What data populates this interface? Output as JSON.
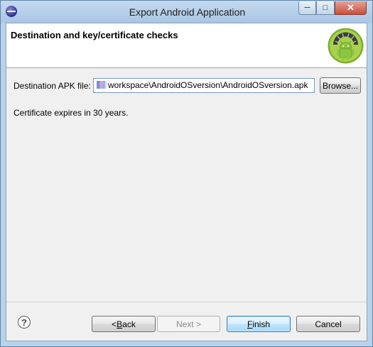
{
  "window": {
    "title": "Export Android Application",
    "icons": {
      "app": "eclipse-icon",
      "minimize": "minimize-icon",
      "maximize": "maximize-icon",
      "close": "close-icon"
    },
    "minimize_glyph": "─",
    "maximize_glyph": "□",
    "close_glyph": "✕"
  },
  "banner": {
    "title": "Destination and key/certificate checks",
    "logo_icon": "android-logo-icon"
  },
  "destination": {
    "label": "Destination APK file:",
    "value": "workspace\\AndroidOSversion\\AndroidOSversion.apk",
    "browse_label": "Browse..."
  },
  "certificate_message": "Certificate expires in 30 years.",
  "buttons": {
    "help_glyph": "?",
    "back_prefix": "< ",
    "back_mnemonic": "B",
    "back_rest": "ack",
    "next_label": "Next >",
    "finish_mnemonic": "F",
    "finish_rest": "inish",
    "cancel_label": "Cancel"
  },
  "colors": {
    "titlebar": "#b9d1ea",
    "dialog_bg": "#f0f0f0",
    "close_button": "#c7503c",
    "default_button": "#3c7fb1",
    "android_green": "#9bc53d"
  }
}
